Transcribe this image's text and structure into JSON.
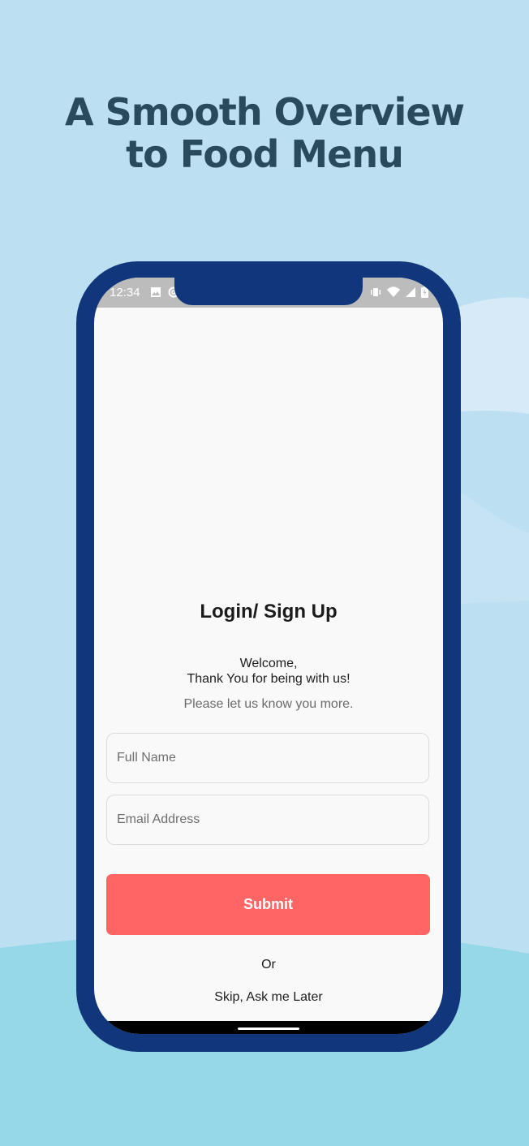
{
  "headline": {
    "line1": "A Smooth Overview",
    "line2": "to Food Menu"
  },
  "status_bar": {
    "time": "12:34",
    "left_icons": [
      "image-icon",
      "at-sign-icon"
    ],
    "right_icons": [
      "vibrate-icon",
      "wifi-icon",
      "signal-icon",
      "battery-icon"
    ]
  },
  "screen": {
    "title": "Login/ Sign Up",
    "welcome_line1": "Welcome,",
    "welcome_line2": "Thank You for being with us!",
    "prompt": "Please let us know you more.",
    "full_name": {
      "placeholder": "Full Name",
      "value": ""
    },
    "email": {
      "placeholder": "Email Address",
      "value": ""
    },
    "submit_label": "Submit",
    "or_label": "Or",
    "skip_label": "Skip, Ask me Later"
  },
  "colors": {
    "background": "#bddff2",
    "headline": "#29495c",
    "phone_frame": "#12367b",
    "submit_button": "#ff6565",
    "ground": "#96d8e8"
  }
}
